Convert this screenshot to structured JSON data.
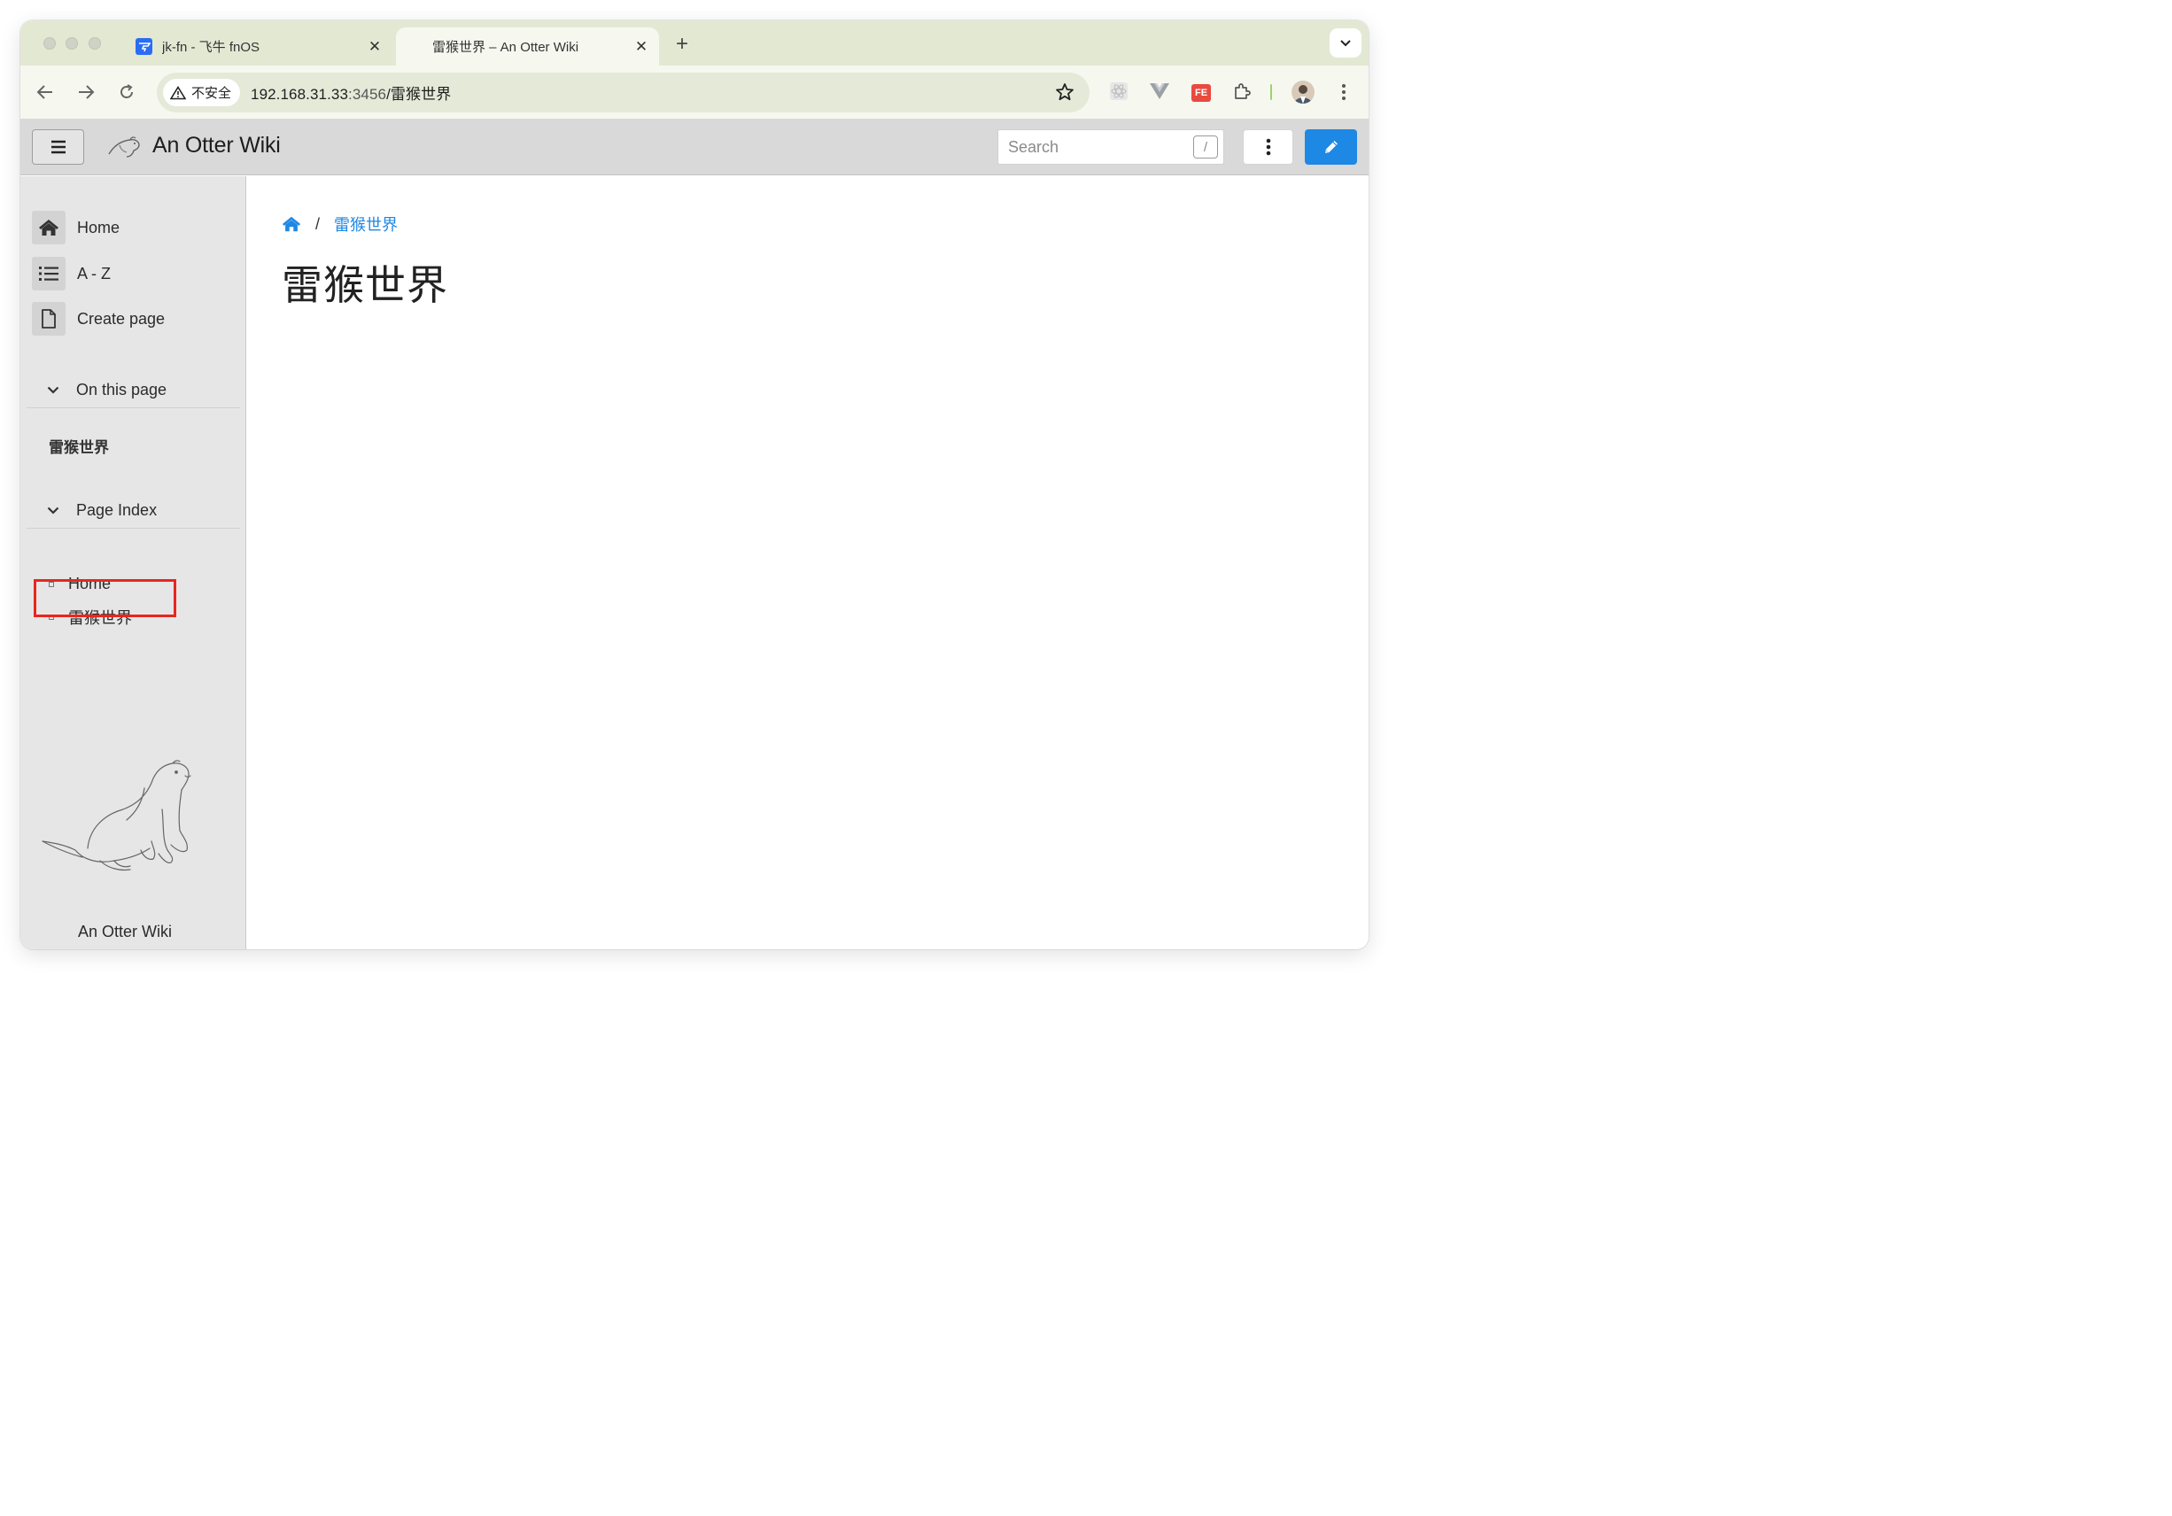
{
  "browser": {
    "tabs": [
      {
        "title": "jk-fn - 飞牛 fnOS",
        "favicon": "fnos-favicon",
        "active": false
      },
      {
        "title": "雷猴世界 – An Otter Wiki",
        "favicon": "",
        "active": true
      }
    ],
    "security_label": "不安全",
    "url_host": "192.168.31.33",
    "url_port": ":3456",
    "url_path": "/雷猴世界",
    "ext_fe_label": "FE"
  },
  "header": {
    "site_title": "An Otter Wiki",
    "search_placeholder": "Search",
    "search_shortcut": "/"
  },
  "sidebar": {
    "nav": [
      {
        "label": "Home",
        "icon": "home-icon"
      },
      {
        "label": "A - Z",
        "icon": "list-icon"
      },
      {
        "label": "Create page",
        "icon": "file-icon"
      }
    ],
    "on_this_page_label": "On this page",
    "toc_items": [
      "雷猴世界"
    ],
    "page_index_label": "Page Index",
    "page_index": [
      "Home",
      "雷猴世界"
    ],
    "footer": "An Otter Wiki"
  },
  "content": {
    "breadcrumb_current": "雷猴世界",
    "breadcrumb_separator": "/",
    "page_title": "雷猴世界"
  },
  "colors": {
    "accent": "#1e88e5",
    "highlight": "#e8261f",
    "tabstrip": "#e3e8d3"
  }
}
